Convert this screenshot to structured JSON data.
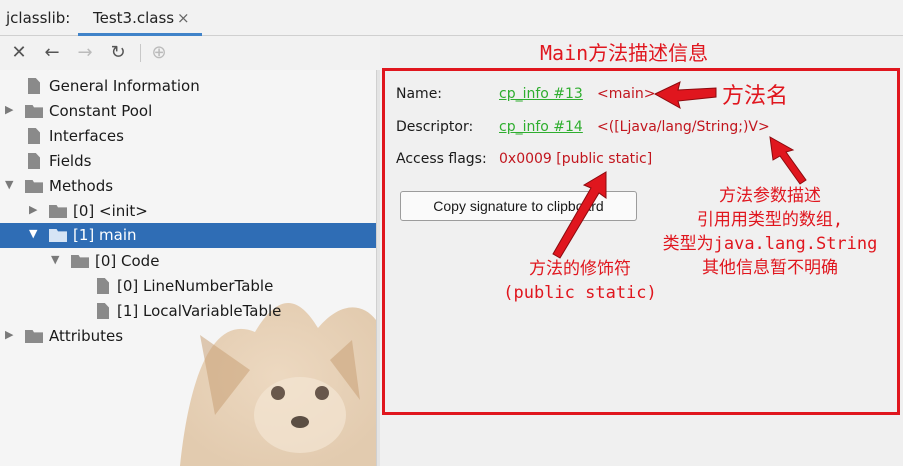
{
  "window": {
    "tool_name": "jclasslib:",
    "tab_label": "Test3.class",
    "tab_close": "×"
  },
  "toolbar": {
    "close_glyph": "✕",
    "back_glyph": "←",
    "forward_glyph": "→",
    "refresh_glyph": "↻",
    "web_glyph": "⊕"
  },
  "tree": {
    "nodes": [
      {
        "label": "General Information",
        "icon": "file-icon"
      },
      {
        "label": "Constant Pool",
        "icon": "folder-icon",
        "expander": "▶"
      },
      {
        "label": "Interfaces",
        "icon": "file-icon"
      },
      {
        "label": "Fields",
        "icon": "file-icon"
      },
      {
        "label": "Methods",
        "icon": "folder-icon",
        "expander": "▼"
      },
      {
        "label": "[0] <init>",
        "icon": "folder-icon",
        "expander": "▶"
      },
      {
        "label": "[1] main",
        "icon": "folder-icon",
        "expander": "▼",
        "selected": true
      },
      {
        "label": "[0] Code",
        "icon": "folder-icon",
        "expander": "▼"
      },
      {
        "label": "[0] LineNumberTable",
        "icon": "file-icon"
      },
      {
        "label": "[1] LocalVariableTable",
        "icon": "file-icon"
      },
      {
        "label": "Attributes",
        "icon": "folder-icon",
        "expander": "▶"
      }
    ]
  },
  "detail": {
    "name_key": "Name:",
    "name_link": "cp_info #13",
    "name_value": "<main>",
    "descriptor_key": "Descriptor:",
    "descriptor_link": "cp_info #14",
    "descriptor_value": "<([Ljava/lang/String;)V>",
    "access_key": "Access flags:",
    "access_value": "0x0009 [public static]",
    "copy_button": "Copy signature to clipboard"
  },
  "annotations": {
    "title": "Main方法描述信息",
    "method_name": "方法名",
    "modifier": [
      "方法的修饰符",
      "(public static)"
    ],
    "descriptor": [
      "方法参数描述",
      "引用用类型的数组,",
      "类型为java.lang.String",
      "其他信息暂不明确"
    ]
  },
  "colors": {
    "selection": "#2f6db5",
    "annotation_red": "#e0161e",
    "link_green": "#2fae2f",
    "value_red": "#c2161e",
    "tab_underline": "#4083c9"
  }
}
